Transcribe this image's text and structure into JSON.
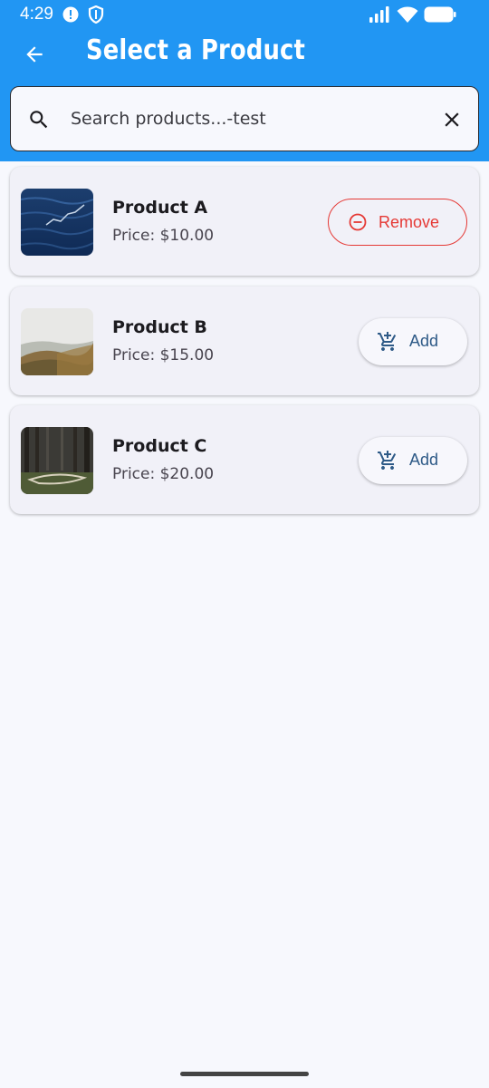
{
  "status_bar": {
    "time": "4:29",
    "icons": [
      "alert-icon",
      "shield-icon",
      "signal-icon",
      "wifi-icon",
      "battery-icon"
    ]
  },
  "app_bar": {
    "title": "Select a Product",
    "back_icon": "arrow-left-icon",
    "color": "#2196f3"
  },
  "search": {
    "value": "",
    "placeholder": "Search products...-test",
    "search_icon": "search-icon",
    "clear_icon": "close-icon"
  },
  "products": [
    {
      "name": "Product A",
      "price": "Price: $10.00",
      "action": "Remove",
      "action_icon": "minus-circle-icon",
      "image": "ocean-water"
    },
    {
      "name": "Product B",
      "price": "Price: $15.00",
      "action": "Add",
      "action_icon": "cart-add-icon",
      "image": "misty-hills"
    },
    {
      "name": "Product C",
      "price": "Price: $20.00",
      "action": "Add",
      "action_icon": "cart-add-icon",
      "image": "forest-path"
    }
  ],
  "colors": {
    "remove": "#e53935",
    "add": "#2e5a87",
    "background": "#f7f8fd"
  }
}
